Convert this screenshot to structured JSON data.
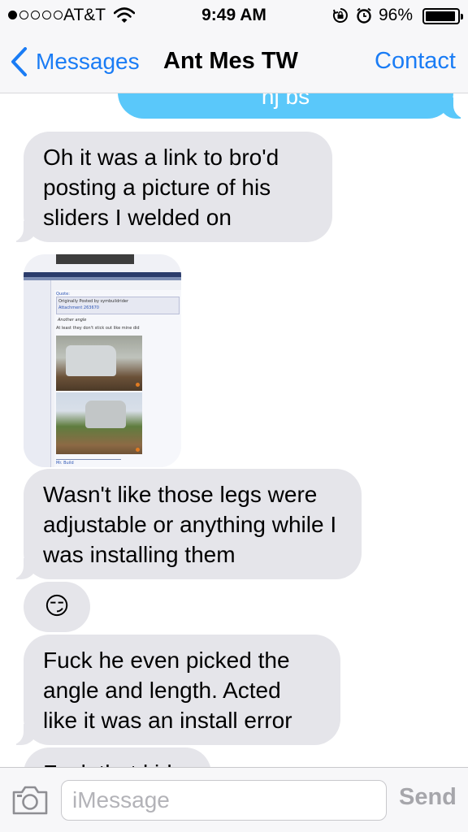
{
  "status_bar": {
    "carrier": "AT&T",
    "time": "9:49 AM",
    "battery": "96%",
    "battery_level": 0.96,
    "signal_bars": 1
  },
  "nav": {
    "back_label": "Messages",
    "title": "Ant Mes TW",
    "contact_label": "Contact"
  },
  "messages": [
    {
      "direction": "outgoing",
      "text": "hj bs"
    },
    {
      "direction": "incoming",
      "text": "Oh it was a link to bro'd posting a picture of his sliders I welded on"
    },
    {
      "direction": "incoming",
      "type": "image",
      "text_lines": [
        "Quote:",
        "Originally Posted by symbuildrider",
        "Attachment 263670",
        "Another angle",
        "At least they don't stick out like mine did",
        "Mr. Build"
      ]
    },
    {
      "direction": "incoming",
      "text": "Wasn't like those legs were adjustable or anything while I was installing them"
    },
    {
      "direction": "incoming",
      "type": "emoji",
      "text": "😏"
    },
    {
      "direction": "incoming",
      "text": "Fuck he even picked the angle and length. Acted like it was an install error"
    },
    {
      "direction": "incoming",
      "text": "Fuck that kid"
    }
  ],
  "composer": {
    "placeholder": "iMessage",
    "send_label": "Send"
  },
  "colors": {
    "accent": "#1a7cf5",
    "incoming_bubble": "#e5e5ea",
    "outgoing_bubble": "#5ac8fa"
  },
  "icons": [
    "wifi-icon",
    "rotation-lock-icon",
    "alarm-icon",
    "battery-icon",
    "chevron-left-icon",
    "camera-icon"
  ]
}
